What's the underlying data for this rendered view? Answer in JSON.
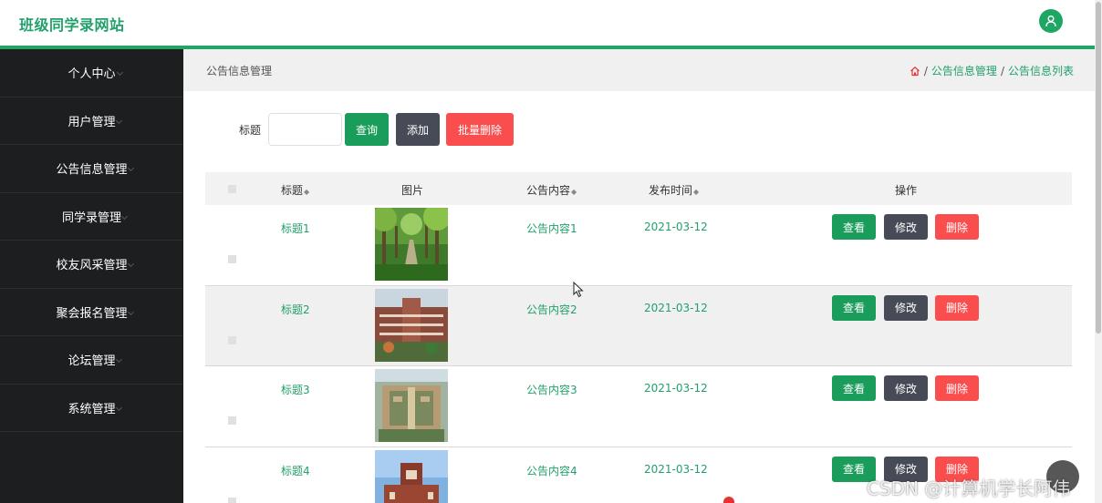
{
  "header": {
    "site_title": "班级同学录网站"
  },
  "sidebar": {
    "items": [
      {
        "label": "个人中心"
      },
      {
        "label": "用户管理"
      },
      {
        "label": "公告信息管理"
      },
      {
        "label": "同学录管理"
      },
      {
        "label": "校友风采管理"
      },
      {
        "label": "聚会报名管理"
      },
      {
        "label": "论坛管理"
      },
      {
        "label": "系统管理"
      }
    ]
  },
  "breadcrumb": {
    "page_title": "公告信息管理",
    "items": [
      "公告信息管理",
      "公告信息列表"
    ],
    "separator": "/"
  },
  "search": {
    "title_label": "标题",
    "title_value": "",
    "query_button": "查询",
    "add_button": "添加",
    "bulk_delete_button": "批量删除"
  },
  "table": {
    "columns": {
      "title": "标题",
      "image": "图片",
      "content": "公告内容",
      "publish_time": "发布时间",
      "actions": "操作"
    },
    "sort_glyph": "◆",
    "rows": [
      {
        "title": "标题1",
        "content": "公告内容1",
        "time": "2021-03-12",
        "view": "查看",
        "edit": "修改",
        "delete": "删除"
      },
      {
        "title": "标题2",
        "content": "公告内容2",
        "time": "2021-03-12",
        "view": "查看",
        "edit": "修改",
        "delete": "删除"
      },
      {
        "title": "标题3",
        "content": "公告内容3",
        "time": "2021-03-12",
        "view": "查看",
        "edit": "修改",
        "delete": "删除"
      },
      {
        "title": "标题4",
        "content": "公告内容4",
        "time": "2021-03-12",
        "view": "查看",
        "edit": "修改",
        "delete": "删除"
      }
    ]
  },
  "watermark": "CSDN @计算机学长阿伟",
  "colors": {
    "brand_green": "#1fa663",
    "text_green": "#22a06b",
    "dark_button": "#474b57",
    "danger": "#fa4e4e",
    "sidebar_bg": "#1d1e20"
  },
  "icons": {
    "avatar": "user-icon",
    "home": "home-icon",
    "sort": "sort-icon",
    "back_to_top": "back-to-top-icon"
  }
}
